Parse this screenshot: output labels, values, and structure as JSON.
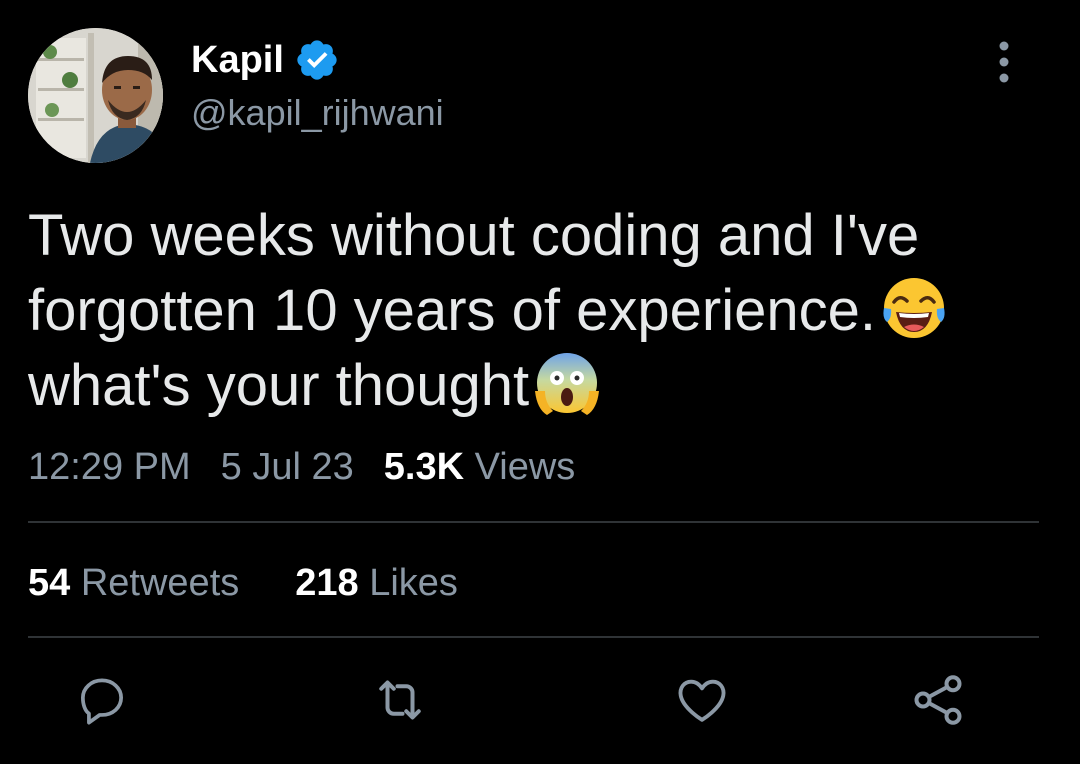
{
  "author": {
    "display_name": "Kapil",
    "handle": "@kapil_rijhwani",
    "verified": true,
    "avatar_icon": "avatar-photo"
  },
  "tweet": {
    "lines": [
      "Two weeks without coding and I've",
      "forgotten 10 years of experience.",
      "what's your thought"
    ],
    "emojis": [
      "face-with-tears-of-joy",
      "face-screaming-in-fear"
    ]
  },
  "meta": {
    "time": "12:29 PM",
    "date": "5 Jul 23",
    "views_count": "5.3K",
    "views_label": "Views"
  },
  "stats": {
    "retweets_count": "54",
    "retweets_label": "Retweets",
    "likes_count": "218",
    "likes_label": "Likes"
  },
  "actions": [
    "reply-icon",
    "retweet-icon",
    "like-icon",
    "share-icon"
  ],
  "colors": {
    "background": "#000000",
    "primary_text": "#e7e9ea",
    "secondary_text": "#8b98a5",
    "verified_blue": "#1d9bf0",
    "divider": "#2f3336"
  }
}
